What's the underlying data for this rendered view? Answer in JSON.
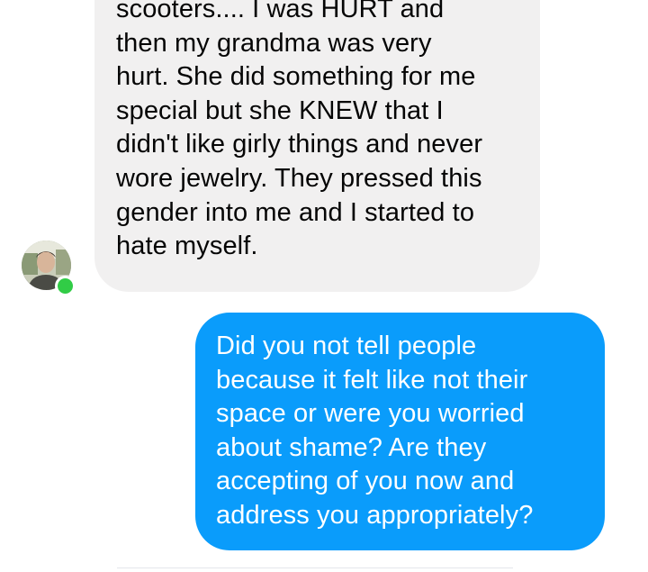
{
  "messages": {
    "incoming": {
      "lines": [
        "scooters.... I was HURT and",
        "then my grandma was very",
        "hurt. She did something for me",
        "special but she KNEW that I",
        "didn't like girly things and never",
        "wore jewelry. They pressed this",
        "gender into me and I started to",
        "hate myself."
      ]
    },
    "outgoing": {
      "lines": [
        "Did you not tell people",
        "because it felt like not their",
        "space or were you worried",
        "about shame? Are they",
        "accepting of you now and",
        "address you appropriately?"
      ]
    }
  },
  "colors": {
    "incoming_bubble": "#f1f0f0",
    "outgoing_bubble": "#0a9cfb",
    "online_status": "#31cc46"
  },
  "icons": {
    "avatar": "contact-avatar",
    "presence": "online-status-dot"
  }
}
